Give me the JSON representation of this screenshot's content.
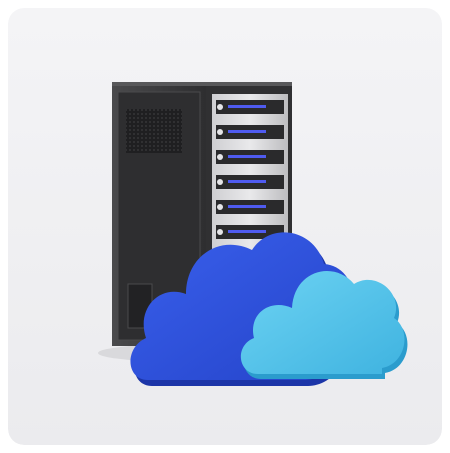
{
  "illustration": {
    "icon": "server-cloud-icon",
    "colors": {
      "card_background": "#efeff1",
      "server_case": "#3a3a3c",
      "server_case_dark": "#262628",
      "server_rack": "#d8d8da",
      "drive_light": "#4f5bf0",
      "cloud_dark_blue": "#2f54dc",
      "cloud_light_blue": "#4fc3ea"
    }
  }
}
